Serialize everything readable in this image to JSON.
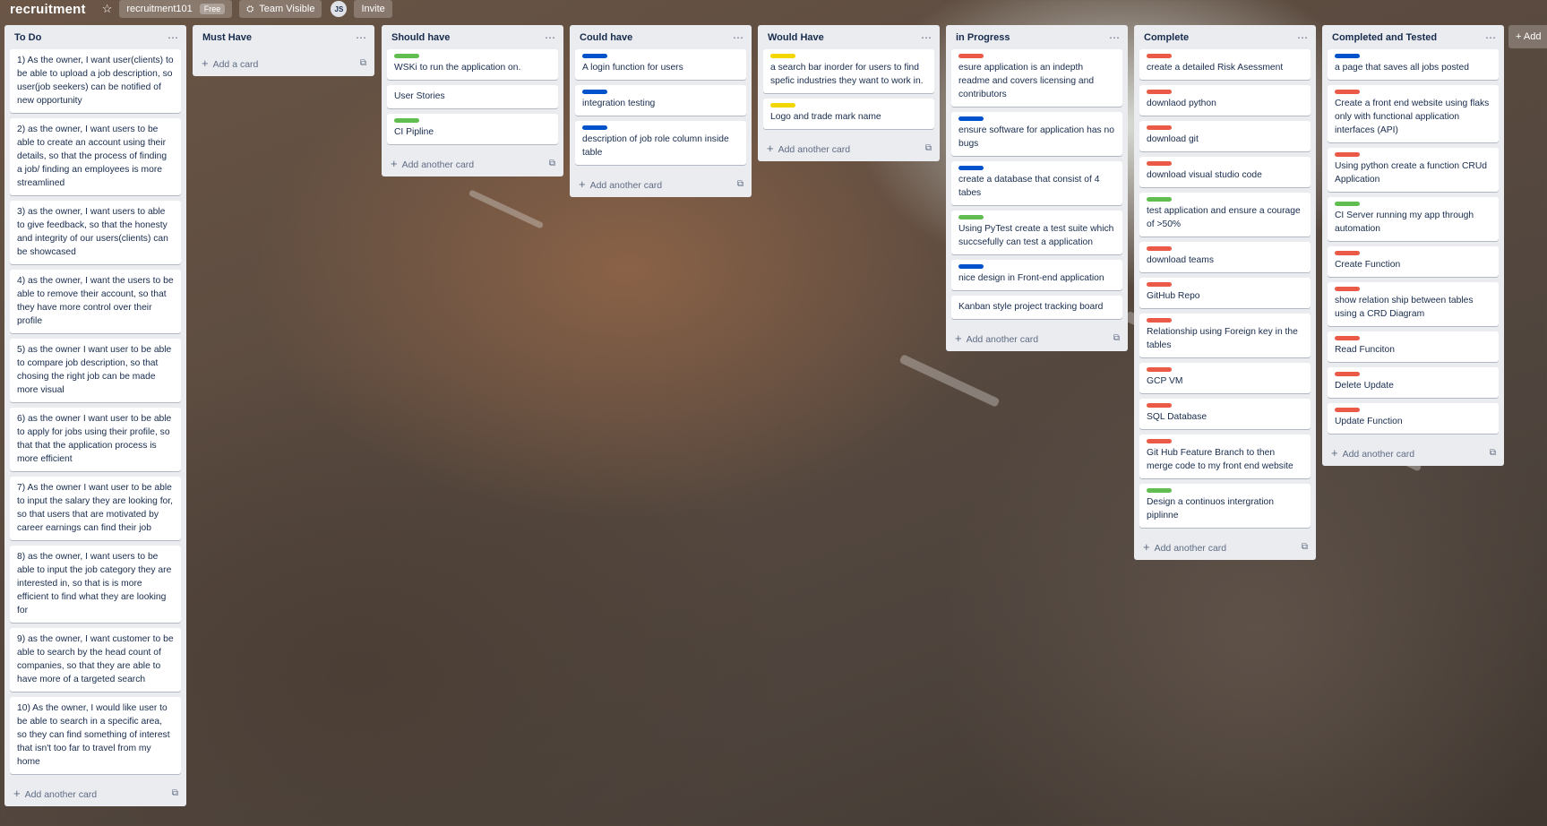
{
  "topbar": {
    "board_title": "recruitment",
    "star_icon": "star-icon",
    "workspace": "recruitment101",
    "plan_badge": "Free",
    "visibility": "Team Visible",
    "avatar_initials": "JS",
    "invite": "Invite"
  },
  "labels": {
    "red": "#eb5a46",
    "blue": "#0052cc",
    "green": "#61bd4f",
    "yellow": "#f2d600"
  },
  "lists": [
    {
      "title": "To Do",
      "footer": "Add another card",
      "cards": [
        {
          "text": "1) As the owner, I want user(clients) to be able to upload a job description, so user(job seekers) can be notified of new opportunity"
        },
        {
          "text": "2) as the owner, I want users to be able to create an account using their details, so that the process of finding a job/ finding an employees is more streamlined"
        },
        {
          "text": "3) as the owner, I want users to able to give feedback, so that the honesty and integrity of our users(clients) can be showcased"
        },
        {
          "text": "4) as the owner, I want the users to be able to remove their account, so that they have more control over their profile"
        },
        {
          "text": "5) as the owner I want user to be able to compare job description, so that chosing the right job can be made more visual"
        },
        {
          "text": "6) as the owner I want user to be able to apply for jobs using their profile, so that that the application process is more efficient"
        },
        {
          "text": "7) As the owner I want user to be able to input the salary they are looking for, so that users that are motivated by career earnings can find their job"
        },
        {
          "text": "8) as the owner, I want users to be able to input the job category they are interested in, so that is is more efficient to find what they are looking for"
        },
        {
          "text": "9) as the owner, I want customer to be able to search by the head count of companies, so that they are able to have more of a targeted search"
        },
        {
          "text": "10) As the owner, I would like user to be able to search in a specific area, so they can find something of interest that isn't too far to travel from my home"
        }
      ]
    },
    {
      "title": "Must Have",
      "footer": "Add a card",
      "cards": []
    },
    {
      "title": "Should have",
      "footer": "Add another card",
      "cards": [
        {
          "text": "WSKi to run the application on.",
          "label": "green"
        },
        {
          "text": "User Stories"
        },
        {
          "text": "CI Pipline",
          "label": "green"
        }
      ]
    },
    {
      "title": "Could have",
      "footer": "Add another card",
      "cards": [
        {
          "text": "A login function for users",
          "label": "blue"
        },
        {
          "text": "integration testing",
          "label": "blue"
        },
        {
          "text": "description of job role column inside table",
          "label": "blue"
        }
      ]
    },
    {
      "title": "Would Have",
      "footer": "Add another card",
      "cards": [
        {
          "text": "a search bar inorder for users to find spefic industries they want to work in.",
          "label": "yellow"
        },
        {
          "text": "Logo and trade mark name",
          "label": "yellow"
        }
      ]
    },
    {
      "title": "in Progress",
      "footer": "Add another card",
      "cards": [
        {
          "text": "esure application is an indepth readme and covers licensing and contributors",
          "label": "red"
        },
        {
          "text": "ensure software for application has no bugs",
          "label": "blue"
        },
        {
          "text": "create a database that consist of 4 tabes",
          "label": "blue"
        },
        {
          "text": "Using PyTest create a test suite which succsefully can test a application",
          "label": "green"
        },
        {
          "text": "nice design in Front-end application",
          "label": "blue"
        },
        {
          "text": "Kanban style project tracking board"
        }
      ]
    },
    {
      "title": "Complete",
      "footer": "Add another card",
      "cards": [
        {
          "text": "create a detailed Risk Asessment",
          "label": "red"
        },
        {
          "text": "downlaod python",
          "label": "red"
        },
        {
          "text": "download git",
          "label": "red"
        },
        {
          "text": "download visual studio code",
          "label": "red"
        },
        {
          "text": "test application and ensure a courage of >50%",
          "label": "green"
        },
        {
          "text": "download teams",
          "label": "red"
        },
        {
          "text": "GitHub Repo",
          "label": "red"
        },
        {
          "text": "Relationship using Foreign key in the tables",
          "label": "red"
        },
        {
          "text": "GCP VM",
          "label": "red"
        },
        {
          "text": "SQL Database",
          "label": "red"
        },
        {
          "text": "Git Hub Feature Branch to then merge code to my front end website",
          "label": "red"
        },
        {
          "text": "Design a continuos intergration piplinne",
          "label": "green"
        }
      ]
    },
    {
      "title": "Completed and Tested",
      "footer": "Add another card",
      "cards": [
        {
          "text": "a page that saves all jobs posted",
          "label": "blue"
        },
        {
          "text": "Create a front end website using flaks only with functional application interfaces (API)",
          "label": "red"
        },
        {
          "text": "Using python create a function CRUd Application",
          "label": "red"
        },
        {
          "text": "CI Server running my app through automation",
          "label": "green"
        },
        {
          "text": "Create Function",
          "label": "red"
        },
        {
          "text": "show relation ship between tables using a CRD Diagram",
          "label": "red"
        },
        {
          "text": "Read Funciton",
          "label": "red"
        },
        {
          "text": "Delete Update",
          "label": "red"
        },
        {
          "text": "Update Function",
          "label": "red"
        }
      ]
    }
  ],
  "add_list": "+ Add"
}
